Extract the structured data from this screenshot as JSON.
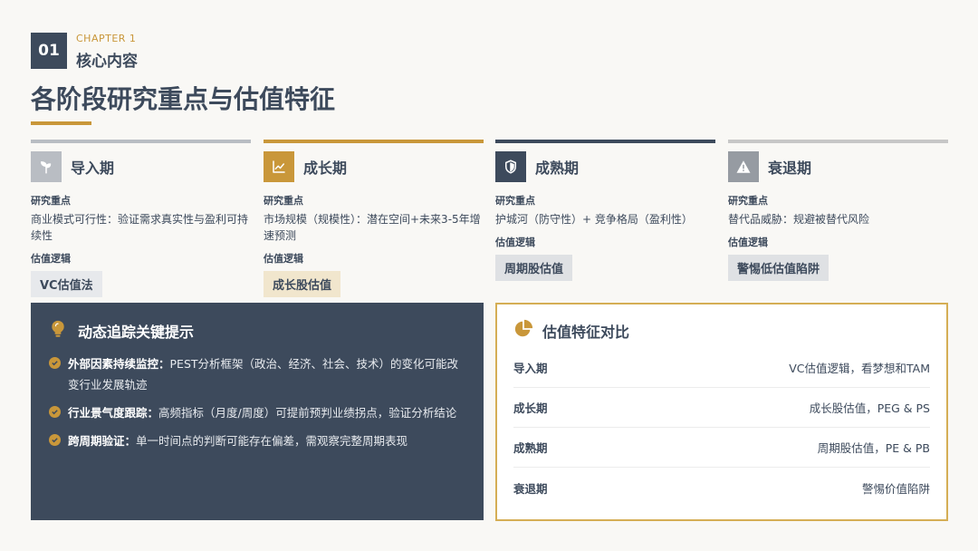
{
  "header": {
    "chapter_number": "01",
    "chapter_label": "CHAPTER 1",
    "chapter_title": "核心内容",
    "page_title": "各阶段研究重点与估值特征"
  },
  "stages": [
    {
      "name": "导入期",
      "icon": "sprout-icon",
      "focus_label": "研究重点",
      "focus_text": "商业模式可行性：验证需求真实性与盈利可持续性",
      "logic_label": "估值逻辑",
      "tag": "VC估值法",
      "colors": {
        "bar": "#b9bdc3",
        "icon_bg": "#b9bdc3",
        "tag_bg": "#e7e9ec"
      }
    },
    {
      "name": "成长期",
      "icon": "trend-chart-icon",
      "focus_label": "研究重点",
      "focus_text": "市场规模（规模性）：潜在空间+未来3-5年增速预测",
      "logic_label": "估值逻辑",
      "tag": "成长股估值",
      "colors": {
        "bar": "#c9973a",
        "icon_bg": "#c9973a",
        "tag_bg": "#f1e6cd"
      }
    },
    {
      "name": "成熟期",
      "icon": "shield-icon",
      "focus_label": "研究重点",
      "focus_text": "护城河（防守性）+ 竞争格局（盈利性）",
      "logic_label": "估值逻辑",
      "tag": "周期股估值",
      "colors": {
        "bar": "#3d4a5c",
        "icon_bg": "#3d4a5c",
        "tag_bg": "#dfe1e4"
      }
    },
    {
      "name": "衰退期",
      "icon": "warning-icon",
      "focus_label": "研究重点",
      "focus_text": "替代品威胁：规避被替代风险",
      "logic_label": "估值逻辑",
      "tag": "警惕低估值陷阱",
      "colors": {
        "bar": "#c7c7c7",
        "icon_bg": "#969ba2",
        "tag_bg": "#dfe1e4"
      }
    }
  ],
  "tracking": {
    "title": "动态追踪关键提示",
    "icon": "lightbulb-icon",
    "items": [
      {
        "strong": "外部因素持续监控：",
        "text": "PEST分析框架（政治、经济、社会、技术）的变化可能改变行业发展轨迹"
      },
      {
        "strong": "行业景气度跟踪：",
        "text": "高频指标（月度/周度）可提前预判业绩拐点，验证分析结论"
      },
      {
        "strong": "跨周期验证：",
        "text": "单一时间点的判断可能存在偏差，需观察完整周期表现"
      }
    ]
  },
  "compare": {
    "title": "估值特征对比",
    "icon": "pie-chart-icon",
    "rows": [
      {
        "stage": "导入期",
        "desc": "VC估值逻辑，看梦想和TAM"
      },
      {
        "stage": "成长期",
        "desc": "成长股估值，PEG & PS"
      },
      {
        "stage": "成熟期",
        "desc": "周期股估值，PE & PB"
      },
      {
        "stage": "衰退期",
        "desc": "警惕价值陷阱"
      }
    ]
  },
  "colors": {
    "navy": "#3d4a5c",
    "gold": "#c9973a",
    "background": "#f9f8f5"
  }
}
